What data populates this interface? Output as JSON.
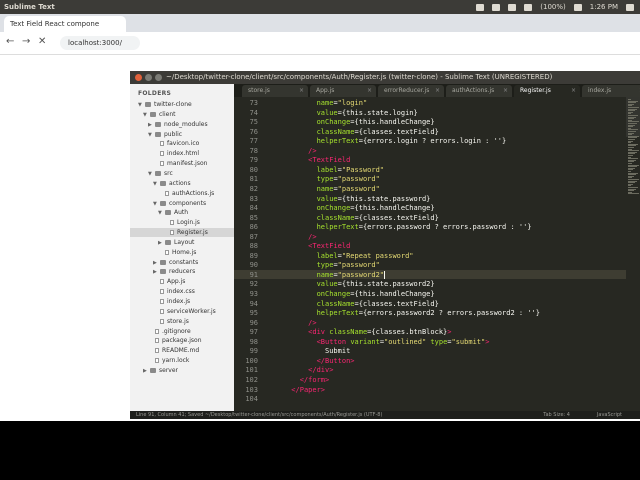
{
  "os_bar": {
    "app_name": "Sublime Text",
    "battery": "(100%)",
    "time": "1:26 PM"
  },
  "browser": {
    "tab_title": "Text Field React compone",
    "url": "localhost:3000/"
  },
  "window": {
    "title": "~/Desktop/twitter-clone/client/src/components/Auth/Register.js (twitter-clone) - Sublime Text (UNREGISTERED)"
  },
  "sidebar": {
    "header": "FOLDERS",
    "items": [
      {
        "label": "twitter-clone",
        "kind": "folder",
        "open": true
      },
      {
        "label": "client",
        "kind": "folder",
        "open": true
      },
      {
        "label": "node_modules",
        "kind": "folder",
        "open": false
      },
      {
        "label": "public",
        "kind": "folder",
        "open": true
      },
      {
        "label": "favicon.ico",
        "kind": "file"
      },
      {
        "label": "index.html",
        "kind": "file"
      },
      {
        "label": "manifest.json",
        "kind": "file"
      },
      {
        "label": "src",
        "kind": "folder",
        "open": true
      },
      {
        "label": "actions",
        "kind": "folder",
        "open": true
      },
      {
        "label": "authActions.js",
        "kind": "file"
      },
      {
        "label": "components",
        "kind": "folder",
        "open": true
      },
      {
        "label": "Auth",
        "kind": "folder",
        "open": true
      },
      {
        "label": "Login.js",
        "kind": "file"
      },
      {
        "label": "Register.js",
        "kind": "file",
        "selected": true
      },
      {
        "label": "Layout",
        "kind": "folder",
        "open": false
      },
      {
        "label": "Home.js",
        "kind": "file"
      },
      {
        "label": "constants",
        "kind": "folder",
        "open": false
      },
      {
        "label": "reducers",
        "kind": "folder",
        "open": false
      },
      {
        "label": "App.js",
        "kind": "file"
      },
      {
        "label": "index.css",
        "kind": "file"
      },
      {
        "label": "index.js",
        "kind": "file"
      },
      {
        "label": "serviceWorker.js",
        "kind": "file"
      },
      {
        "label": "store.js",
        "kind": "file"
      },
      {
        "label": ".gitignore",
        "kind": "file"
      },
      {
        "label": "package.json",
        "kind": "file"
      },
      {
        "label": "README.md",
        "kind": "file"
      },
      {
        "label": "yarn.lock",
        "kind": "file"
      },
      {
        "label": "server",
        "kind": "folder",
        "open": false
      }
    ]
  },
  "tabs": [
    {
      "label": "store.js"
    },
    {
      "label": "App.js"
    },
    {
      "label": "errorReducer.js"
    },
    {
      "label": "authActions.js"
    },
    {
      "label": "Register.js",
      "active": true
    },
    {
      "label": "index.js"
    }
  ],
  "editor": {
    "lines": [
      {
        "n": "73",
        "parts": [
          [
            "t-txt",
            "            "
          ],
          [
            "t-attr",
            "name"
          ],
          [
            "t-txt",
            "="
          ],
          [
            "t-str",
            "\"login\""
          ]
        ]
      },
      {
        "n": "74",
        "parts": [
          [
            "t-txt",
            "            "
          ],
          [
            "t-attr",
            "value"
          ],
          [
            "t-txt",
            "={this.state.login}"
          ]
        ]
      },
      {
        "n": "75",
        "parts": [
          [
            "t-txt",
            "            "
          ],
          [
            "t-attr",
            "onChange"
          ],
          [
            "t-txt",
            "={this.handleChange}"
          ]
        ]
      },
      {
        "n": "76",
        "parts": [
          [
            "t-txt",
            "            "
          ],
          [
            "t-attr",
            "className"
          ],
          [
            "t-txt",
            "={classes.textField}"
          ]
        ]
      },
      {
        "n": "77",
        "parts": [
          [
            "t-txt",
            "            "
          ],
          [
            "t-attr",
            "helperText"
          ],
          [
            "t-txt",
            "={errors.login ? errors.login : ''}"
          ]
        ]
      },
      {
        "n": "78",
        "parts": [
          [
            "t-txt",
            "          "
          ],
          [
            "t-tag",
            "/>"
          ]
        ]
      },
      {
        "n": "79",
        "parts": [
          [
            "t-txt",
            "          "
          ],
          [
            "t-tag",
            "<TextField"
          ]
        ]
      },
      {
        "n": "80",
        "parts": [
          [
            "t-txt",
            "            "
          ],
          [
            "t-attr",
            "label"
          ],
          [
            "t-txt",
            "="
          ],
          [
            "t-str",
            "\"Password\""
          ]
        ]
      },
      {
        "n": "81",
        "parts": [
          [
            "t-txt",
            "            "
          ],
          [
            "t-attr",
            "type"
          ],
          [
            "t-txt",
            "="
          ],
          [
            "t-str",
            "\"password\""
          ]
        ]
      },
      {
        "n": "82",
        "parts": [
          [
            "t-txt",
            "            "
          ],
          [
            "t-attr",
            "name"
          ],
          [
            "t-txt",
            "="
          ],
          [
            "t-str",
            "\"password\""
          ]
        ]
      },
      {
        "n": "83",
        "parts": [
          [
            "t-txt",
            "            "
          ],
          [
            "t-attr",
            "value"
          ],
          [
            "t-txt",
            "={this.state.password}"
          ]
        ]
      },
      {
        "n": "84",
        "parts": [
          [
            "t-txt",
            "            "
          ],
          [
            "t-attr",
            "onChange"
          ],
          [
            "t-txt",
            "={this.handleChange}"
          ]
        ]
      },
      {
        "n": "85",
        "parts": [
          [
            "t-txt",
            "            "
          ],
          [
            "t-attr",
            "className"
          ],
          [
            "t-txt",
            "={classes.textField}"
          ]
        ]
      },
      {
        "n": "86",
        "parts": [
          [
            "t-txt",
            "            "
          ],
          [
            "t-attr",
            "helperText"
          ],
          [
            "t-txt",
            "={errors.password ? errors.password : ''}"
          ]
        ]
      },
      {
        "n": "87",
        "parts": [
          [
            "t-txt",
            "          "
          ],
          [
            "t-tag",
            "/>"
          ]
        ]
      },
      {
        "n": "88",
        "parts": [
          [
            "t-txt",
            "          "
          ],
          [
            "t-tag",
            "<TextField"
          ]
        ]
      },
      {
        "n": "89",
        "parts": [
          [
            "t-txt",
            "            "
          ],
          [
            "t-attr",
            "label"
          ],
          [
            "t-txt",
            "="
          ],
          [
            "t-str",
            "\"Repeat password\""
          ]
        ]
      },
      {
        "n": "90",
        "parts": [
          [
            "t-txt",
            "            "
          ],
          [
            "t-attr",
            "type"
          ],
          [
            "t-txt",
            "="
          ],
          [
            "t-str",
            "\"password\""
          ]
        ]
      },
      {
        "n": "91",
        "parts": [
          [
            "t-txt",
            "            "
          ],
          [
            "t-attr",
            "name"
          ],
          [
            "t-txt",
            "="
          ],
          [
            "t-str",
            "\"password2\""
          ]
        ],
        "cursor": true
      },
      {
        "n": "92",
        "parts": [
          [
            "t-txt",
            "            "
          ],
          [
            "t-attr",
            "value"
          ],
          [
            "t-txt",
            "={this.state.password2}"
          ]
        ]
      },
      {
        "n": "93",
        "parts": [
          [
            "t-txt",
            "            "
          ],
          [
            "t-attr",
            "onChange"
          ],
          [
            "t-txt",
            "={this.handleChange}"
          ]
        ]
      },
      {
        "n": "94",
        "parts": [
          [
            "t-txt",
            "            "
          ],
          [
            "t-attr",
            "className"
          ],
          [
            "t-txt",
            "={classes.textField}"
          ]
        ]
      },
      {
        "n": "95",
        "parts": [
          [
            "t-txt",
            "            "
          ],
          [
            "t-attr",
            "helperText"
          ],
          [
            "t-txt",
            "={errors.password2 ? errors.password2 : ''}"
          ]
        ]
      },
      {
        "n": "96",
        "parts": [
          [
            "t-txt",
            "          "
          ],
          [
            "t-tag",
            "/>"
          ]
        ]
      },
      {
        "n": "97",
        "parts": [
          [
            "t-txt",
            "          "
          ],
          [
            "t-tag",
            "<div"
          ],
          [
            "t-txt",
            " "
          ],
          [
            "t-attr",
            "className"
          ],
          [
            "t-txt",
            "={classes.btnBlock}"
          ],
          [
            "t-tag",
            ">"
          ]
        ]
      },
      {
        "n": "98",
        "parts": [
          [
            "t-txt",
            "            "
          ],
          [
            "t-tag",
            "<Button"
          ],
          [
            "t-txt",
            " "
          ],
          [
            "t-attr",
            "variant"
          ],
          [
            "t-txt",
            "="
          ],
          [
            "t-str",
            "\"outlined\""
          ],
          [
            "t-txt",
            " "
          ],
          [
            "t-attr",
            "type"
          ],
          [
            "t-txt",
            "="
          ],
          [
            "t-str",
            "\"submit\""
          ],
          [
            "t-tag",
            ">"
          ]
        ]
      },
      {
        "n": "99",
        "parts": [
          [
            "t-txt",
            "              Submit"
          ]
        ]
      },
      {
        "n": "100",
        "parts": [
          [
            "t-txt",
            "            "
          ],
          [
            "t-tag",
            "</Button>"
          ]
        ]
      },
      {
        "n": "101",
        "parts": [
          [
            "t-txt",
            "          "
          ],
          [
            "t-tag",
            "</div>"
          ]
        ]
      },
      {
        "n": "102",
        "parts": [
          [
            "t-txt",
            "        "
          ],
          [
            "t-tag",
            "</form>"
          ]
        ]
      },
      {
        "n": "103",
        "parts": [
          [
            "t-txt",
            "      "
          ],
          [
            "t-tag",
            "</Paper>"
          ]
        ]
      },
      {
        "n": "104",
        "parts": [
          [
            "t-txt",
            ""
          ]
        ]
      }
    ]
  },
  "status": {
    "left": "Line 91, Column 41; Saved ~/Desktop/twitter-clone/client/src/components/Auth/Register.js (UTF-8)",
    "tab_size": "Tab Size: 4",
    "syntax": "JavaScript"
  },
  "colors": {
    "editor_bg": "#272822",
    "tag": "#f92672",
    "attr": "#a6e22e",
    "string": "#e6db74"
  }
}
